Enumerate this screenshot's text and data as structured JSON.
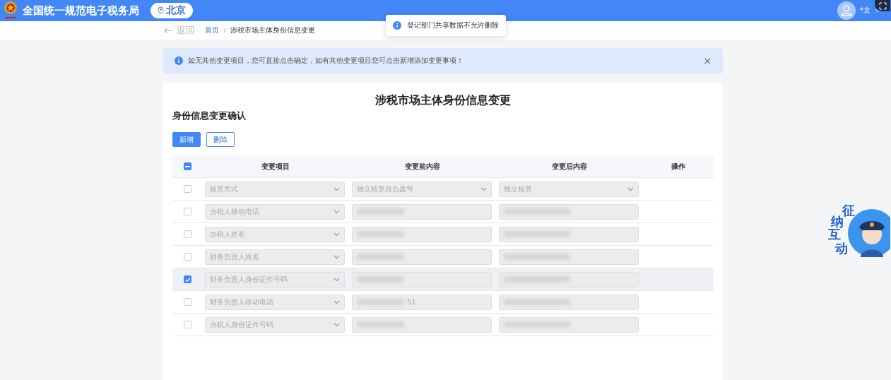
{
  "header": {
    "site_title": "全国统一规范电子税务局",
    "region": "北京",
    "user_name": "*京"
  },
  "toast": {
    "message": "登记部门共享数据不允许删除"
  },
  "nav": {
    "back": "返回",
    "breadcrumbs": [
      "首页",
      "涉税市场主体身份信息变更"
    ]
  },
  "alert": {
    "message": "如无其他变更项目，您可直接点击确定，如有其他变更项目您可点击新增添加变更事项！",
    "close": "×"
  },
  "page_title": "涉税市场主体身份信息变更",
  "section_title": "身份信息变更确认",
  "buttons": [
    {
      "label": "新增",
      "kind": "primary"
    },
    {
      "label": "删除",
      "kind": "outline"
    }
  ],
  "table": {
    "select_all": {
      "indeterminate": true
    },
    "columns": [
      "变更项目",
      "变更前内容",
      "变更后内容",
      "操作"
    ],
    "rows": [
      {
        "checked": false,
        "item": "核算方式",
        "before": {
          "kind": "select",
          "value": "独立核算自负盈亏",
          "redacted": false
        },
        "after": {
          "kind": "select",
          "value": "独立核算",
          "redacted": false
        }
      },
      {
        "checked": false,
        "item": "办税人移动电话",
        "before": {
          "kind": "text",
          "redacted": true
        },
        "after": {
          "kind": "text",
          "redacted": true
        }
      },
      {
        "checked": false,
        "item": "办税人姓名",
        "before": {
          "kind": "text",
          "redacted": true
        },
        "after": {
          "kind": "text",
          "redacted": true
        }
      },
      {
        "checked": false,
        "item": "财务负责人姓名",
        "before": {
          "kind": "text",
          "redacted": true
        },
        "after": {
          "kind": "text",
          "redacted": true
        }
      },
      {
        "checked": true,
        "item": "财务负责人身份证件号码",
        "before": {
          "kind": "text",
          "redacted": true
        },
        "after": {
          "kind": "text",
          "redacted": true
        }
      },
      {
        "checked": false,
        "item": "财务负责人移动电话",
        "before": {
          "kind": "text",
          "value": "51",
          "redacted": true
        },
        "after": {
          "kind": "text",
          "redacted": true
        }
      },
      {
        "checked": false,
        "item": "办税人身份证件号码",
        "before": {
          "kind": "text",
          "redacted": true
        },
        "after": {
          "kind": "text",
          "redacted": true
        }
      }
    ]
  },
  "assistant": {
    "characters": [
      "征",
      "纳",
      "互",
      "动"
    ]
  }
}
